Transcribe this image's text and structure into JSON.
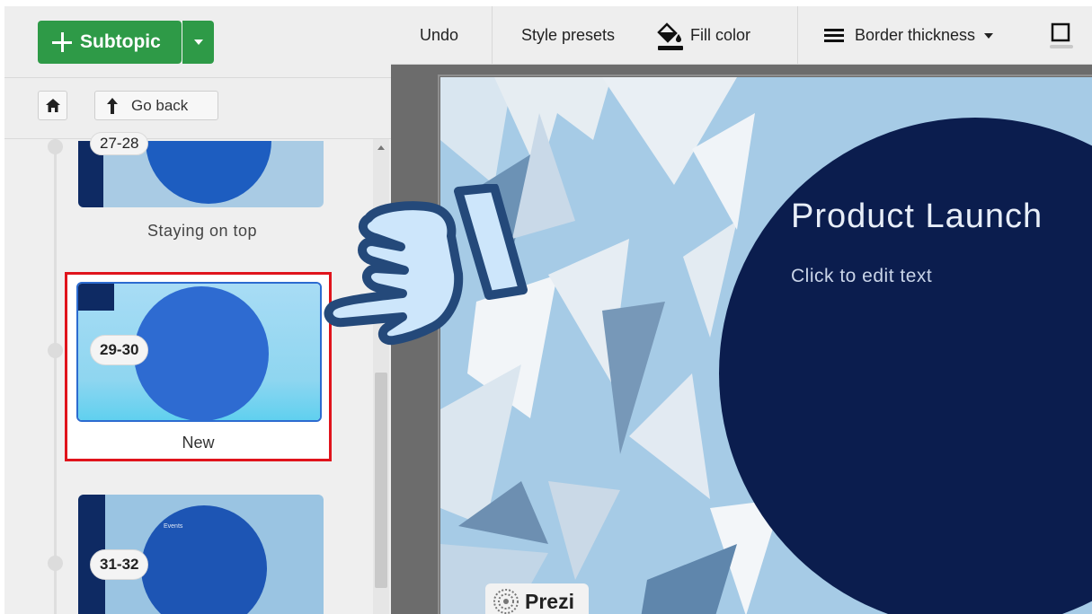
{
  "left_panel": {
    "subtopic_label": "Subtopic",
    "go_back_label": "Go back",
    "slides": [
      {
        "range": "27-28",
        "title": "Staying on top"
      },
      {
        "range": "29-30",
        "title": "New"
      },
      {
        "range": "31-32",
        "title": ""
      }
    ],
    "thumb3_small_text": "Events"
  },
  "toolbar": {
    "undo": "Undo",
    "style_presets": "Style presets",
    "fill_color": "Fill color",
    "border_thickness": "Border thickness"
  },
  "canvas": {
    "title": "Product Launch",
    "subtitle": "Click to edit text",
    "brand": "Prezi"
  },
  "colors": {
    "accent_green": "#2e9a47",
    "highlight_red": "#e0141c",
    "slide_navy": "#0b1d4e",
    "thumb_circle": "#2e6bd1",
    "hand_fill": "#cde6fb",
    "hand_stroke": "#24497a"
  }
}
